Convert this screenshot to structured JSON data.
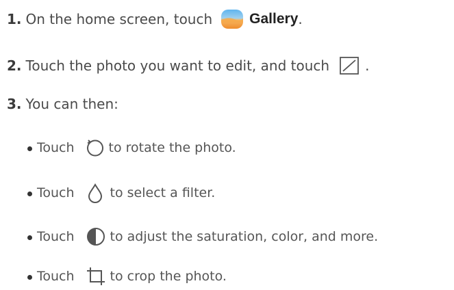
{
  "steps": [
    {
      "number": "1.",
      "text_before": "On the home screen, touch",
      "app_icon": "gallery-app-icon",
      "app_name": "Gallery",
      "text_after": "."
    },
    {
      "number": "2.",
      "text_before": "Touch the photo you want to edit, and touch",
      "icon": "edit-icon",
      "text_after": "."
    },
    {
      "number": "3.",
      "text": "You can then:"
    }
  ],
  "options": [
    {
      "word": "Touch",
      "icon": "rotate-icon",
      "text": "to rotate the photo."
    },
    {
      "word": "Touch",
      "icon": "filter-drop-icon",
      "text": "to select a filter."
    },
    {
      "word": "Touch",
      "icon": "adjust-contrast-icon",
      "text": "to adjust the saturation, color, and more."
    },
    {
      "word": "Touch",
      "icon": "crop-icon",
      "text": "to crop the photo."
    }
  ],
  "colors": {
    "gallery_top": "#4aa3e8",
    "gallery_bottom": "#f39a3a",
    "text": "#4a4a4a"
  }
}
